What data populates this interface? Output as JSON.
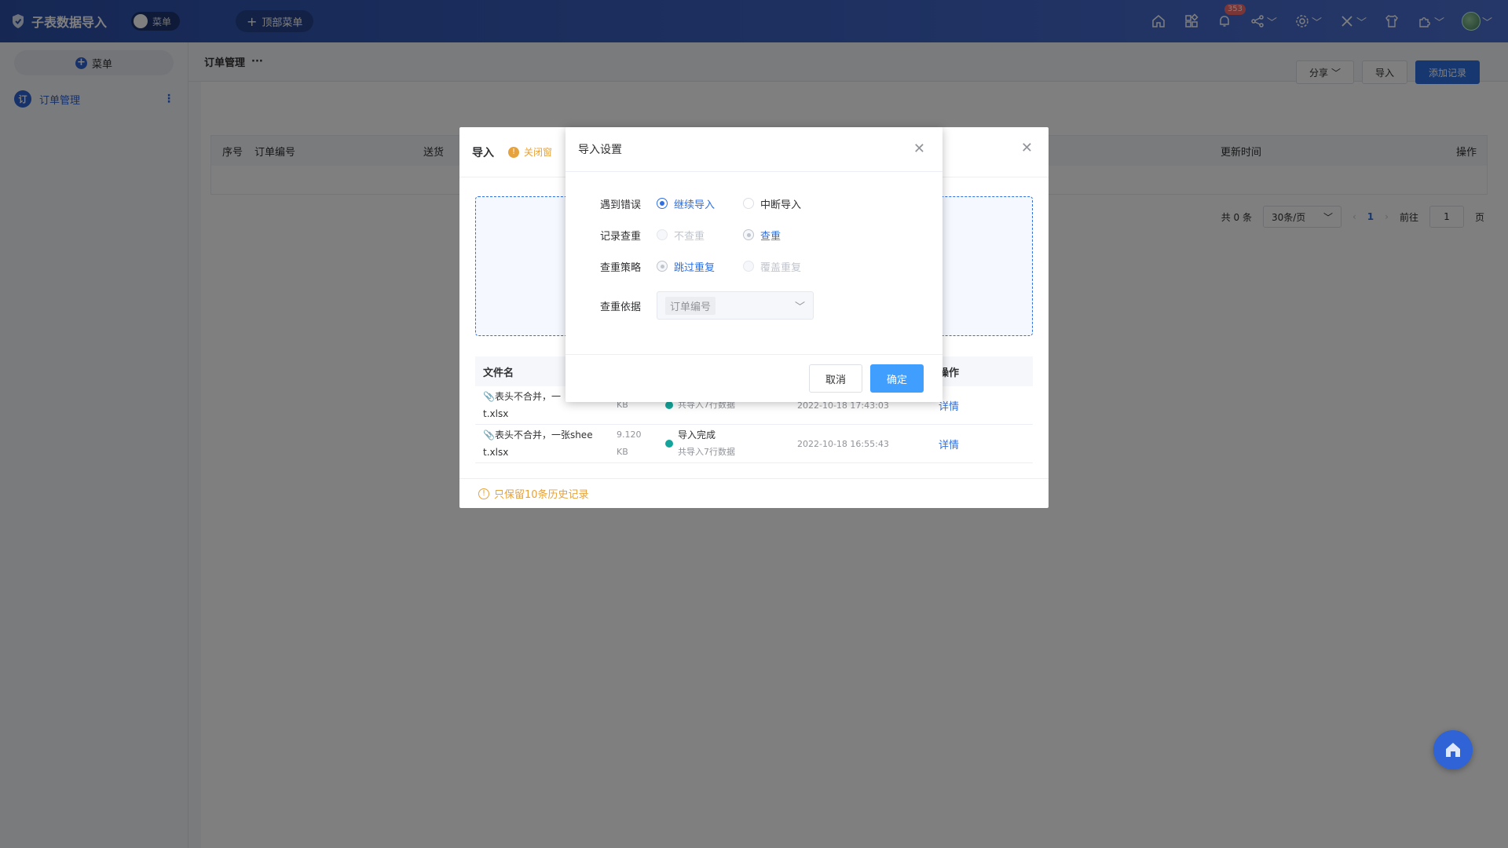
{
  "app": {
    "title": "子表数据导入",
    "toggle_label": "菜单",
    "top_menu_label": "顶部菜单"
  },
  "header": {
    "notification_count": "353"
  },
  "sidebar": {
    "menu_button": "菜单",
    "items": [
      {
        "icon_text": "订",
        "label": "订单管理"
      }
    ]
  },
  "page": {
    "breadcrumb": "订单管理",
    "breadcrumb_more": "···"
  },
  "toolbar": {
    "share": "分享",
    "import": "导入",
    "add": "添加记录"
  },
  "grid": {
    "columns": [
      "序号",
      "订单编号",
      "送货",
      "更新时间",
      "操作"
    ]
  },
  "pager": {
    "total": "共 0 条",
    "page_size": "30条/页",
    "current": "1",
    "goto_label": "前往",
    "goto_value": "1",
    "page_suffix": "页"
  },
  "import_dialog": {
    "title": "导入",
    "warning": "关闭窗",
    "table_headers": {
      "name": "文件名",
      "op": "操作"
    },
    "rows": [
      {
        "name_line1": "表头不合并，一",
        "name_line2": "t.xlsx",
        "size_line1": "",
        "size_line2": "KB",
        "status": "",
        "status_sub": "共导入7行数据",
        "time": "2022-10-18 17:43:03",
        "op": "详情"
      },
      {
        "name_line1": "表头不合并，一张shee",
        "name_line2": "t.xlsx",
        "size_line1": "9.120",
        "size_line2": "KB",
        "status": "导入完成",
        "status_sub": "共导入7行数据",
        "time": "2022-10-18 16:55:43",
        "op": "详情"
      }
    ],
    "footer": "只保留10条历史记录"
  },
  "settings_dialog": {
    "title": "导入设置",
    "rows": {
      "on_error": {
        "label": "遇到错误",
        "opt1": "继续导入",
        "opt2": "中断导入"
      },
      "dedupe": {
        "label": "记录查重",
        "opt1": "不查重",
        "opt2": "查重"
      },
      "strategy": {
        "label": "查重策略",
        "opt1": "跳过重复",
        "opt2": "覆盖重复"
      },
      "basis": {
        "label": "查重依据",
        "value": "订单编号"
      }
    },
    "cancel": "取消",
    "confirm": "确定"
  }
}
